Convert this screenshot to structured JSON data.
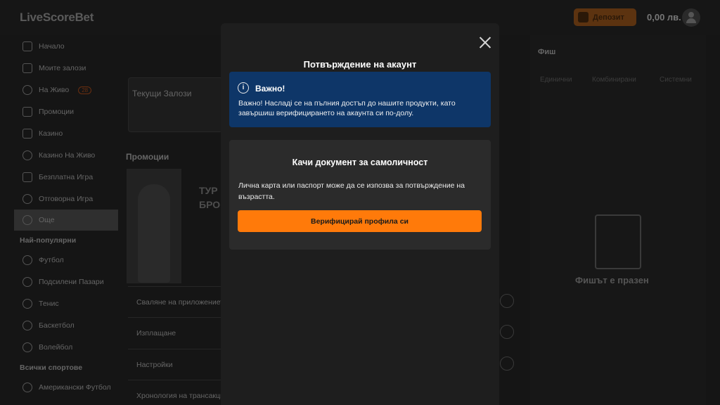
{
  "header": {
    "logo": "LiveScoreBet",
    "deposit_label": "Депозит",
    "balance": "0,00 лв."
  },
  "sidebar": {
    "items": [
      {
        "label": "Начало",
        "icon": "home-icon"
      },
      {
        "label": "Моите залози",
        "icon": "bets-icon"
      },
      {
        "label": "На Живо",
        "icon": "live-icon",
        "badge": "28"
      },
      {
        "label": "Промоции",
        "icon": "tag-icon"
      },
      {
        "label": "Казино",
        "icon": "casino-icon"
      },
      {
        "label": "Казино На Живо",
        "icon": "live-casino-icon"
      },
      {
        "label": "Безплатна Игра",
        "icon": "free-game-icon"
      },
      {
        "label": "Отговорна Игра",
        "icon": "shield-icon"
      },
      {
        "label": "Още",
        "icon": "more-icon"
      }
    ],
    "popular_heading": "Най-популярни",
    "popular": [
      {
        "label": "Футбол",
        "icon": "football-icon"
      },
      {
        "label": "Подсилени Пазари",
        "icon": "boost-icon"
      },
      {
        "label": "Тенис",
        "icon": "tennis-icon"
      },
      {
        "label": "Баскетбол",
        "icon": "basketball-icon"
      },
      {
        "label": "Волейбол",
        "icon": "volleyball-icon"
      }
    ],
    "all_sports_heading": "Всички спортове",
    "all_sports": [
      {
        "label": "Американски Футбол",
        "icon": "american-football-icon"
      }
    ]
  },
  "main": {
    "current_bets_title": "Текущи Залози",
    "promotions_title": "Промоции",
    "promo_line1": "ТУР",
    "promo_line2": "БРО",
    "menu_rows": [
      "Сваляне на приложението",
      "Изплащане",
      "Настройки",
      "Хронология на трансакциите"
    ]
  },
  "betslip": {
    "title": "Фиш",
    "tabs": [
      "Единични",
      "Комбинирани",
      "Системни"
    ],
    "empty_text": "Фишът е празен"
  },
  "modal": {
    "title": "Потвърждение на акаунт",
    "info_title": "Важно!",
    "info_text": "Важно! Насладі се на пълния достъп до нашите продукти, като завършиш верифицирането на акаунта си по-долу.",
    "doc_title": "Качи документ за самоличност",
    "doc_text": "Лична карта или паспорт може да се изпозва за потвърждение на възрастта.",
    "verify_button": "Верифицирай профила си"
  },
  "colors": {
    "accent": "#ff7a0a",
    "info_bg": "#0e3668",
    "modal_bg": "#1e1e1e"
  }
}
